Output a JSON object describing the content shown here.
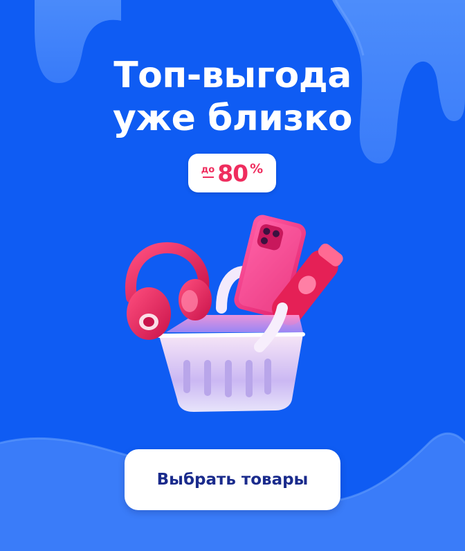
{
  "banner": {
    "title_line1": "Топ-выгода",
    "title_line2": "уже близко",
    "discount": {
      "prefix": "до",
      "value": "80",
      "unit": "%"
    },
    "cta_label": "Выбрать товары",
    "illustration": [
      "shopping-basket-icon",
      "headphones-icon",
      "smartphone-icon",
      "lotion-tube-icon"
    ]
  },
  "colors": {
    "background": "#0f5cf3",
    "accent": "#ef2d5e",
    "button_text": "#1a2b8c",
    "white": "#ffffff"
  }
}
